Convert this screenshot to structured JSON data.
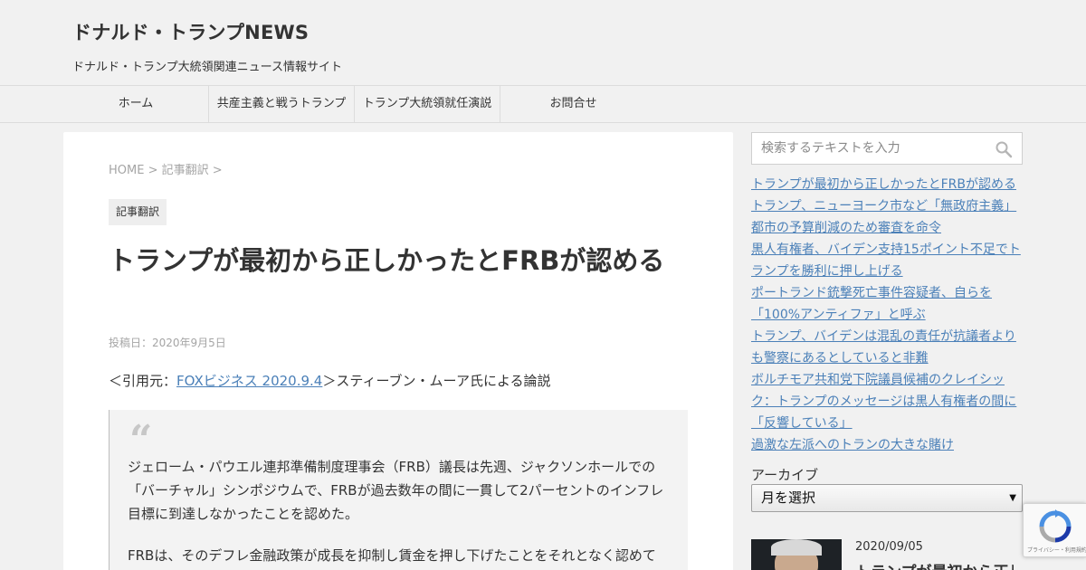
{
  "header": {
    "site_title": "ドナルド・トランプNEWS",
    "site_description": "ドナルド・トランプ大統領関連ニュース情報サイト"
  },
  "nav": {
    "items": [
      {
        "label": "ホーム"
      },
      {
        "label": "共産主義と戦うトランプ"
      },
      {
        "label": "トランプ大統領就任演説"
      },
      {
        "label": "お問合せ"
      }
    ]
  },
  "breadcrumb": {
    "home": "HOME",
    "sep1": ">",
    "category": "記事翻訳",
    "sep2": ">"
  },
  "article": {
    "category_badge": "記事翻訳",
    "title": "トランプが最初から正しかったとFRBが認める",
    "post_date": "投稿日：2020年9月5日",
    "source_prefix": "＜引用元：",
    "source_link": "FOXビジネス 2020.9.4",
    "source_suffix": "＞スティーブン・ムーア氏による論説",
    "quote_mark": "“",
    "quote_paragraphs": [
      "ジェローム・パウエル連邦準備制度理事会（FRB）議長は先週、ジャクソンホールでの「バーチャル」シンポジウムで、FRBが過去数年の間に一貫して2パーセントのインフレ目標に到達しなかったことを認めた。",
      "FRBは、そのデフレ金融政策が成長を抑制し賃金を押し下げたことをそれとなく認めて"
    ]
  },
  "sidebar": {
    "search_placeholder": "検索するテキストを入力",
    "search_icon": "search-icon",
    "recent_posts": [
      "トランプが最初から正しかったとFRBが認める",
      "トランプ、ニューヨーク市など「無政府主義」都市の予算削減のため審査を命令",
      "黒人有権者、バイデン支持15ポイント不足でトランプを勝利に押し上げる",
      "ポートランド銃撃死亡事件容疑者、自らを「100%アンティファ」と呼ぶ",
      "トランプ、バイデンは混乱の責任が抗議者よりも警察にあるとしていると非難",
      "ボルチモア共和党下院議員候補のクレイシック：トランプのメッセージは黒人有権者の間に「反響している」",
      "過激な左派へのトランの大きな賭け"
    ],
    "archive_label": "アーカイブ",
    "archive_select": "月を選択",
    "latest": {
      "date": "2020/09/05",
      "title": "トランプが最初から正しかったとFRBが認める"
    }
  },
  "recaptcha": {
    "text": "プライバシー・利用規約"
  },
  "colors": {
    "background": "#f1f1f1",
    "content": "#ffffff",
    "link": "#4b80b8",
    "muted": "#a5a5a5"
  }
}
